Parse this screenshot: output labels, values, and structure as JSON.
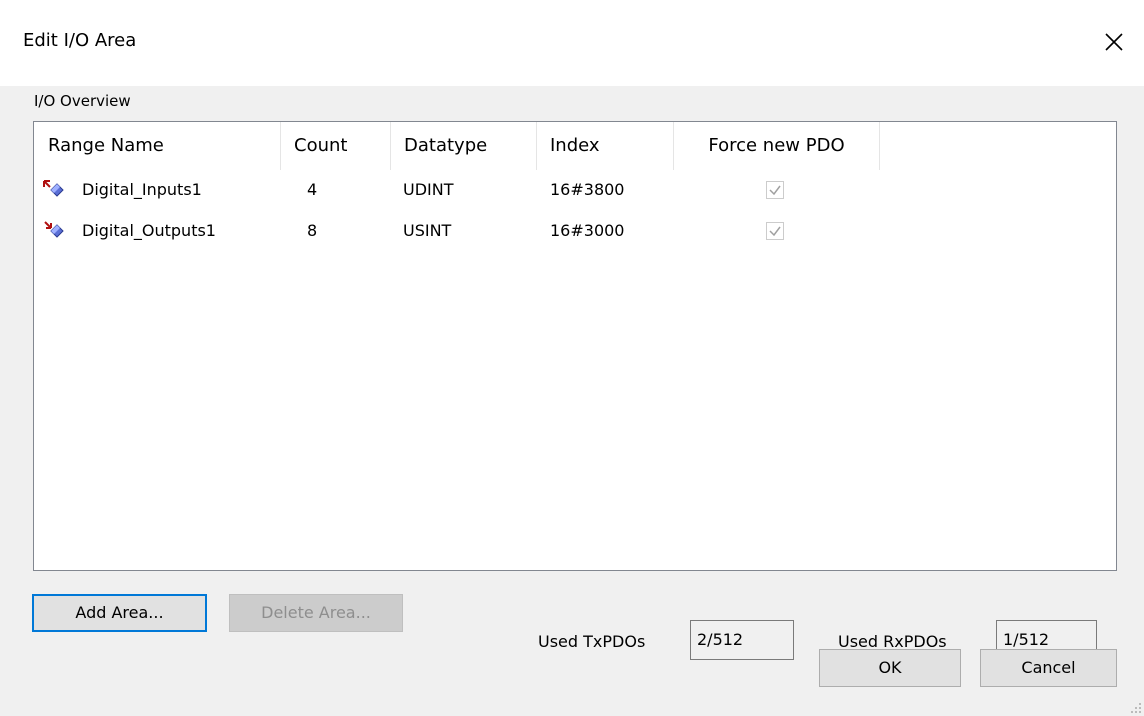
{
  "dialog": {
    "title": "Edit I/O Area"
  },
  "overview": {
    "group_label": "I/O Overview",
    "columns": [
      "Range Name",
      "Count",
      "Datatype",
      "Index",
      "Force new PDO"
    ],
    "rows": [
      {
        "icon": "input-range-icon",
        "name": "Digital_Inputs1",
        "count": "4",
        "datatype": "UDINT",
        "index": "16#3800",
        "force_new_pdo": true
      },
      {
        "icon": "output-range-icon",
        "name": "Digital_Outputs1",
        "count": "8",
        "datatype": "USINT",
        "index": "16#3000",
        "force_new_pdo": true
      }
    ]
  },
  "buttons": {
    "add_area": "Add Area...",
    "delete_area": "Delete Area...",
    "ok": "OK",
    "cancel": "Cancel"
  },
  "usage": {
    "tx_label": "Used TxPDOs",
    "tx_value": "2/512",
    "rx_label": "Used RxPDOs",
    "rx_value": "1/512"
  },
  "colors": {
    "default_button_border": "#0078d7",
    "list_border": "#828790"
  }
}
